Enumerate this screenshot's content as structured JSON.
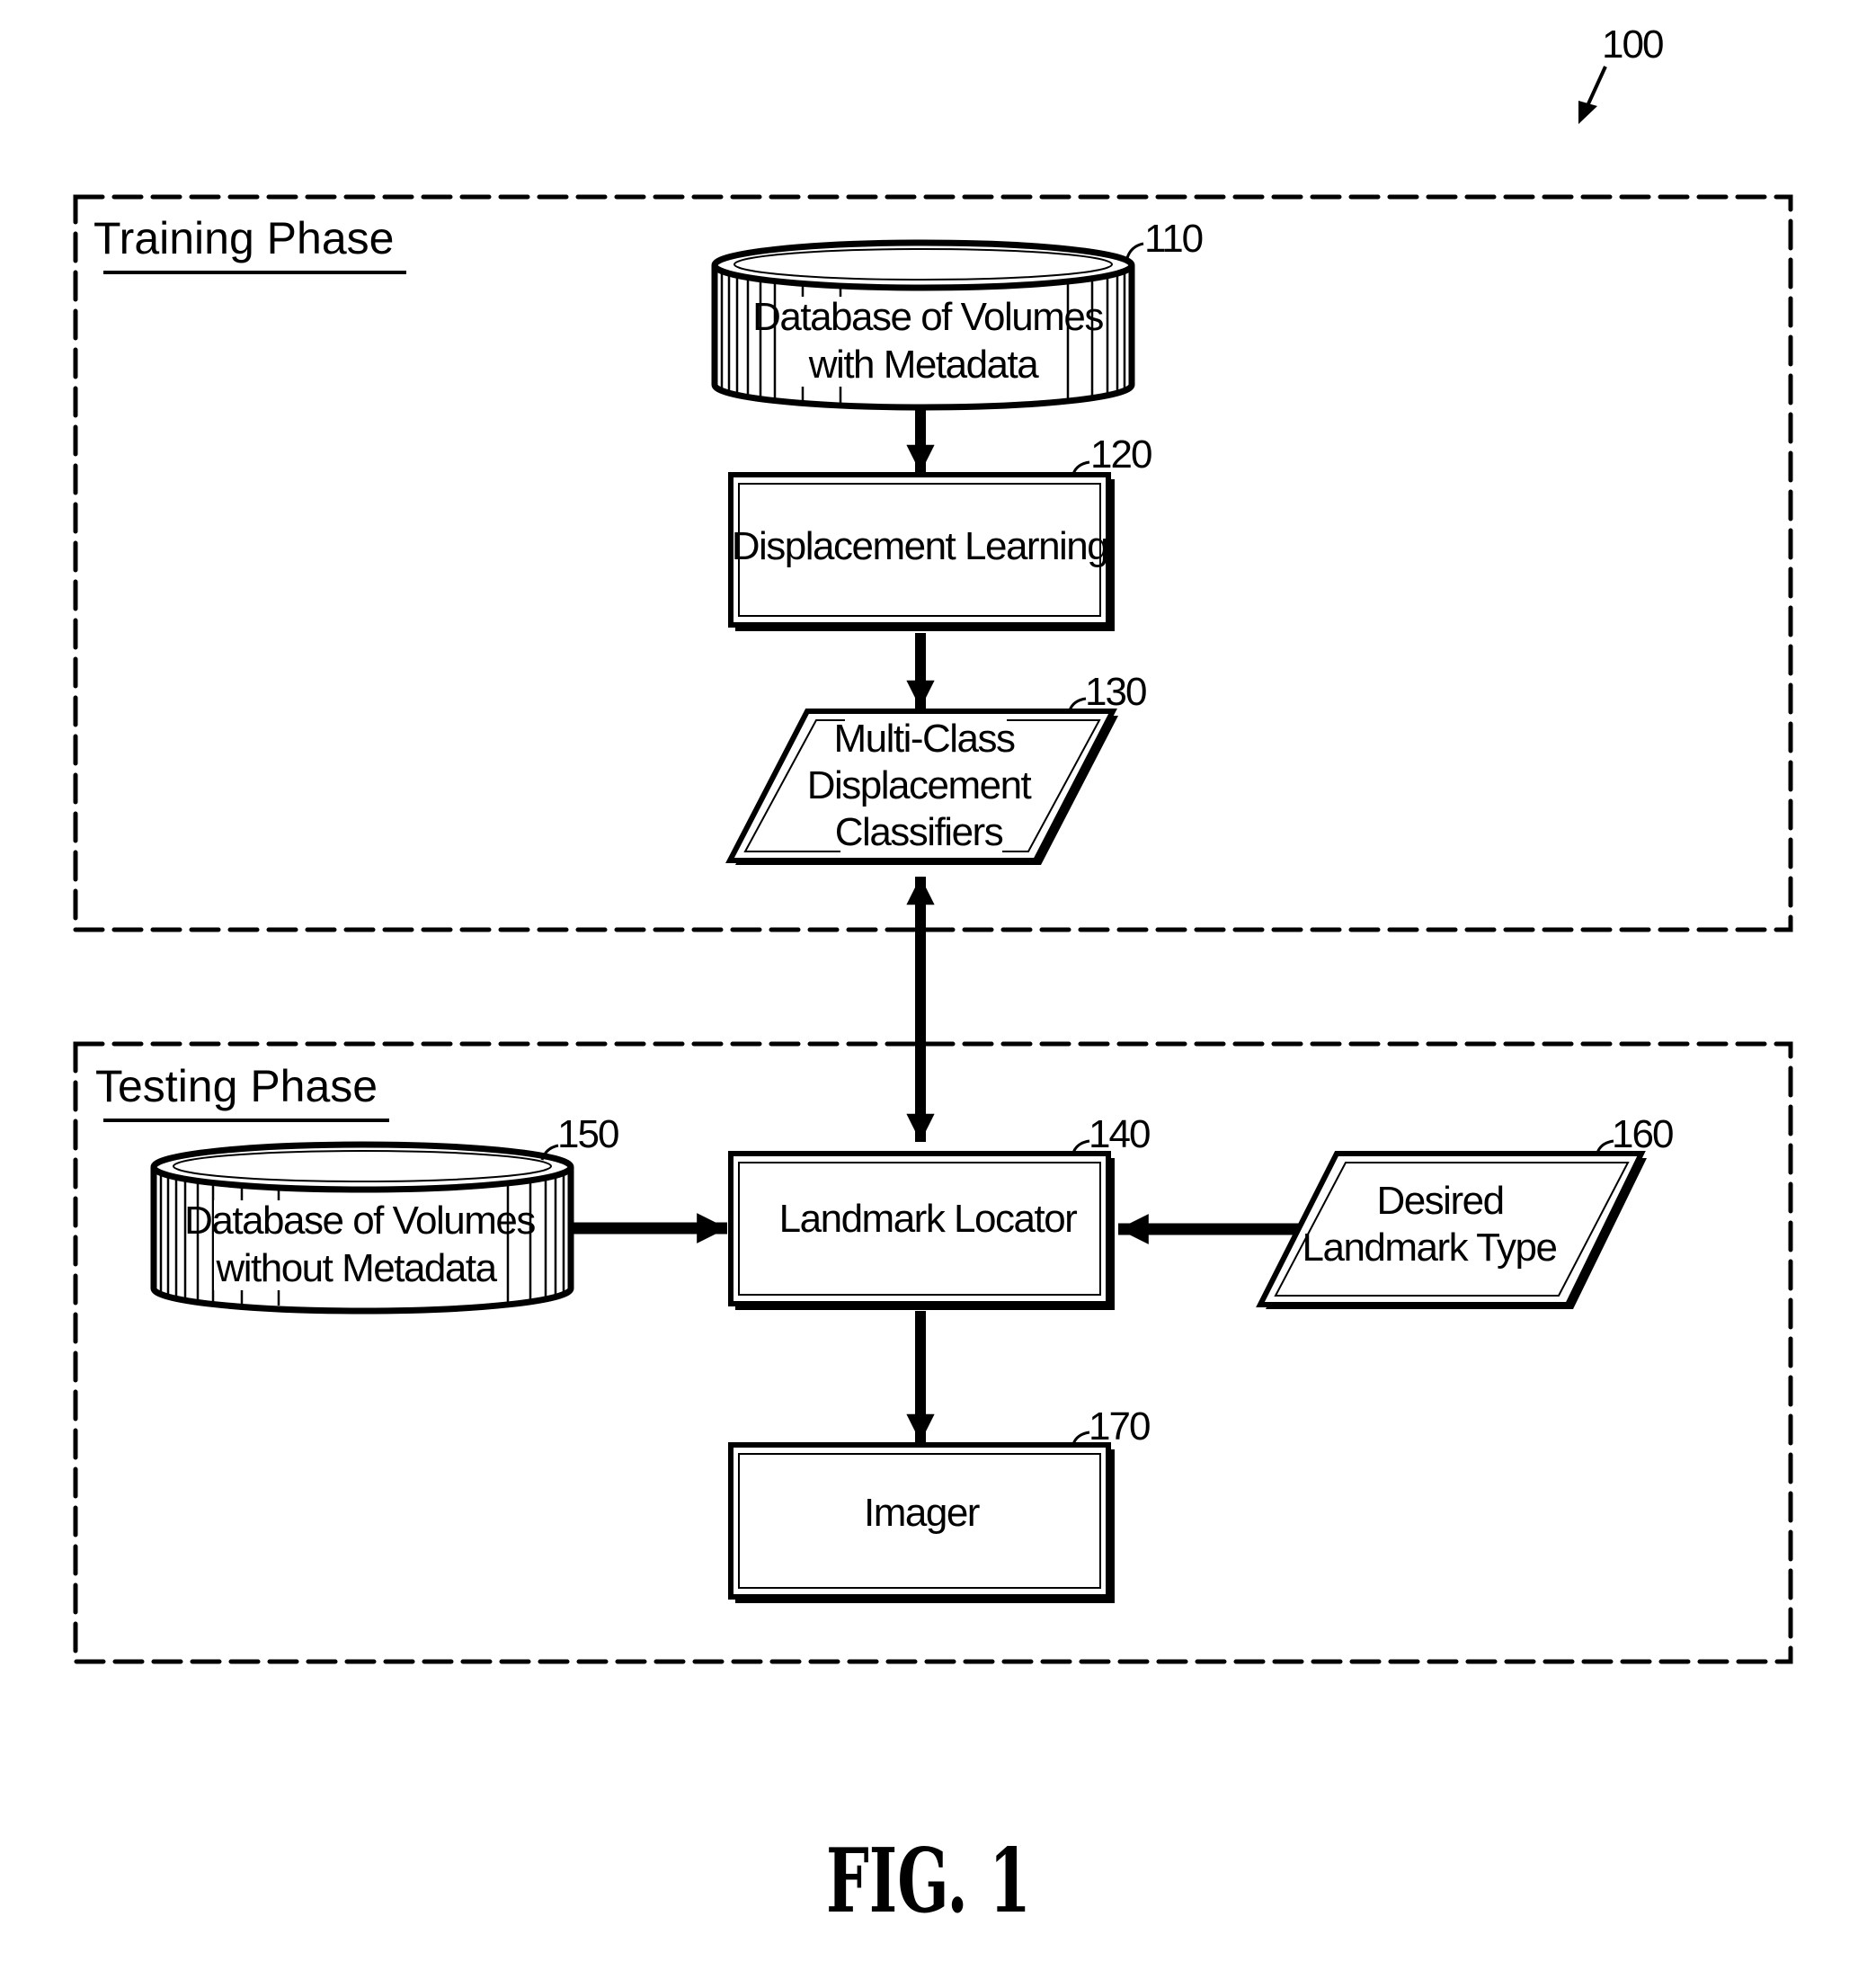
{
  "figure": {
    "reference_numeral": "100",
    "caption": "FIG. 1"
  },
  "phases": {
    "training": {
      "title": "Training Phase"
    },
    "testing": {
      "title": "Testing Phase"
    }
  },
  "nodes": {
    "n110": {
      "ref": "110",
      "shape": "database",
      "lines": [
        "Database of Volumes",
        "with Metadata"
      ]
    },
    "n120": {
      "ref": "120",
      "shape": "process",
      "lines": [
        "Displacement Learning"
      ]
    },
    "n130": {
      "ref": "130",
      "shape": "data",
      "lines": [
        "Multi-Class",
        "Displacement",
        "Classifiers"
      ]
    },
    "n140": {
      "ref": "140",
      "shape": "process",
      "lines": [
        "Landmark Locator"
      ]
    },
    "n150": {
      "ref": "150",
      "shape": "database",
      "lines": [
        "Database of Volumes",
        "without Metadata"
      ]
    },
    "n160": {
      "ref": "160",
      "shape": "data",
      "lines": [
        "Desired",
        "Landmark Type"
      ]
    },
    "n170": {
      "ref": "170",
      "shape": "process",
      "lines": [
        "Imager"
      ]
    }
  },
  "edges": [
    {
      "from": "110",
      "to": "120",
      "direction": "forward"
    },
    {
      "from": "120",
      "to": "130",
      "direction": "forward"
    },
    {
      "from": "130",
      "to": "140",
      "direction": "bidirectional"
    },
    {
      "from": "150",
      "to": "140",
      "direction": "forward"
    },
    {
      "from": "160",
      "to": "140",
      "direction": "forward"
    },
    {
      "from": "140",
      "to": "170",
      "direction": "forward"
    }
  ]
}
